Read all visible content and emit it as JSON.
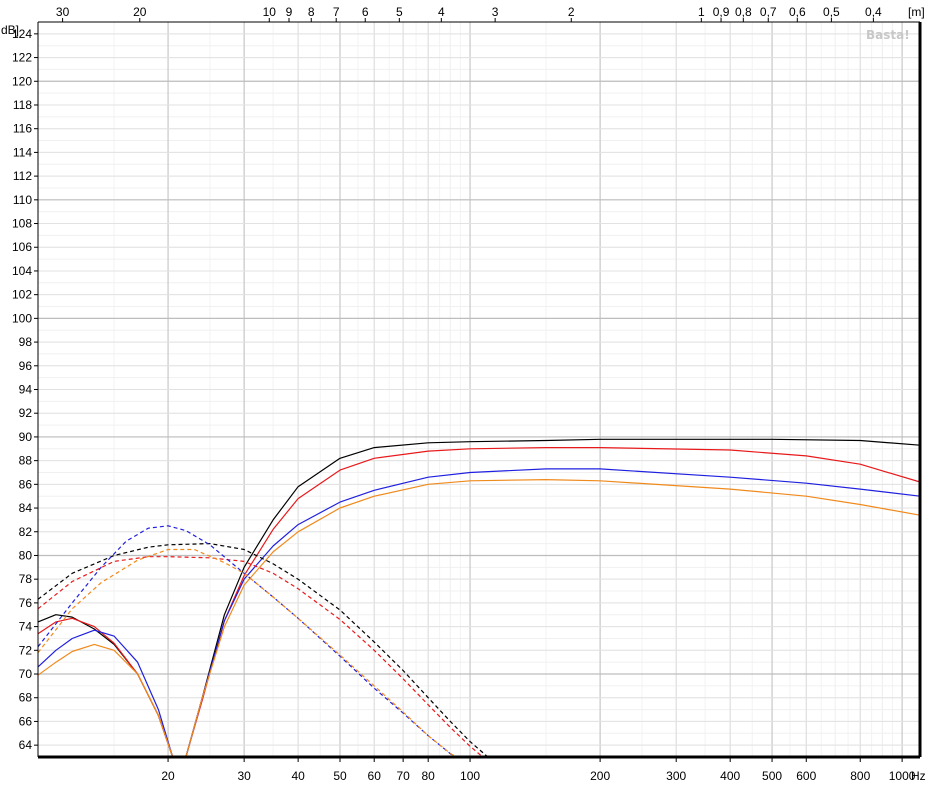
{
  "chart_data": {
    "type": "line",
    "title": "",
    "xlabel": "",
    "ylabel": "",
    "x_scale": "log",
    "xlim": [
      10,
      1100
    ],
    "ylim": [
      63,
      125
    ],
    "grid": true,
    "watermark": "Basta!",
    "y_unit_label": "dB]",
    "x_unit_label": "Hz",
    "top_unit_label": "[m]",
    "x_ticks": [
      {
        "v": 20,
        "label": "20"
      },
      {
        "v": 30,
        "label": "30"
      },
      {
        "v": 40,
        "label": "40"
      },
      {
        "v": 50,
        "label": "50"
      },
      {
        "v": 60,
        "label": "60"
      },
      {
        "v": 70,
        "label": "70"
      },
      {
        "v": 80,
        "label": "80"
      },
      {
        "v": 100,
        "label": "100"
      },
      {
        "v": 200,
        "label": "200"
      },
      {
        "v": 300,
        "label": "300"
      },
      {
        "v": 400,
        "label": "400"
      },
      {
        "v": 500,
        "label": "500"
      },
      {
        "v": 600,
        "label": "600"
      },
      {
        "v": 800,
        "label": "800"
      },
      {
        "v": 1000,
        "label": "1000"
      }
    ],
    "y_ticks": [
      64,
      66,
      68,
      70,
      72,
      74,
      76,
      78,
      80,
      82,
      84,
      86,
      88,
      90,
      92,
      94,
      96,
      98,
      100,
      102,
      104,
      106,
      108,
      110,
      112,
      114,
      116,
      118,
      120,
      122,
      124
    ],
    "top_ticks": [
      {
        "label": "30",
        "hz": 11.4
      },
      {
        "label": "20",
        "hz": 17.2
      },
      {
        "label": "10",
        "hz": 34.3
      },
      {
        "label": "9",
        "hz": 38.1
      },
      {
        "label": "8",
        "hz": 42.9
      },
      {
        "label": "7",
        "hz": 49.0
      },
      {
        "label": "6",
        "hz": 57.2
      },
      {
        "label": "5",
        "hz": 68.6
      },
      {
        "label": "4",
        "hz": 85.8
      },
      {
        "label": "3",
        "hz": 114.3
      },
      {
        "label": "2",
        "hz": 171.5
      },
      {
        "label": "1",
        "hz": 343
      },
      {
        "label": "0,9",
        "hz": 381
      },
      {
        "label": "0,8",
        "hz": 429
      },
      {
        "label": "0,7",
        "hz": 490
      },
      {
        "label": "0,6",
        "hz": 572
      },
      {
        "label": "0,5",
        "hz": 686
      },
      {
        "label": "0,4",
        "hz": 858
      }
    ],
    "series": [
      {
        "color": "#000000",
        "dash": false,
        "points": [
          [
            10,
            74.4
          ],
          [
            11,
            75.0
          ],
          [
            12,
            74.8
          ],
          [
            13.5,
            73.8
          ],
          [
            15,
            72.5
          ],
          [
            17,
            70.0
          ],
          [
            19,
            66.5
          ],
          [
            20.5,
            63
          ]
        ]
      },
      {
        "color": "#000000",
        "dash": false,
        "points": [
          [
            22,
            63
          ],
          [
            24,
            68
          ],
          [
            27,
            75
          ],
          [
            30,
            79
          ],
          [
            35,
            83
          ],
          [
            40,
            85.8
          ],
          [
            50,
            88.2
          ],
          [
            60,
            89.1
          ],
          [
            80,
            89.5
          ],
          [
            100,
            89.6
          ],
          [
            150,
            89.7
          ],
          [
            200,
            89.8
          ],
          [
            500,
            89.8
          ],
          [
            800,
            89.7
          ],
          [
            1100,
            89.3
          ]
        ]
      },
      {
        "color": "#e8191b",
        "dash": false,
        "points": [
          [
            10,
            73.4
          ],
          [
            11,
            74.4
          ],
          [
            12,
            74.7
          ],
          [
            13.5,
            74.0
          ],
          [
            15,
            72.6
          ],
          [
            17,
            70.0
          ],
          [
            19,
            66.5
          ],
          [
            20.5,
            63
          ]
        ]
      },
      {
        "color": "#e8191b",
        "dash": false,
        "points": [
          [
            22,
            63
          ],
          [
            24,
            67.8
          ],
          [
            27,
            74.5
          ],
          [
            30,
            78.3
          ],
          [
            35,
            82.2
          ],
          [
            40,
            84.8
          ],
          [
            50,
            87.2
          ],
          [
            60,
            88.2
          ],
          [
            80,
            88.8
          ],
          [
            100,
            89.0
          ],
          [
            150,
            89.1
          ],
          [
            200,
            89.1
          ],
          [
            400,
            88.9
          ],
          [
            600,
            88.4
          ],
          [
            800,
            87.7
          ],
          [
            1100,
            86.2
          ]
        ]
      },
      {
        "color": "#2020e0",
        "dash": false,
        "points": [
          [
            10,
            70.6
          ],
          [
            11,
            72.0
          ],
          [
            12,
            73.0
          ],
          [
            13.5,
            73.7
          ],
          [
            15,
            73.2
          ],
          [
            17,
            71.0
          ],
          [
            19,
            67.0
          ],
          [
            20.5,
            63
          ]
        ]
      },
      {
        "color": "#2020e0",
        "dash": false,
        "points": [
          [
            22,
            63
          ],
          [
            24,
            68
          ],
          [
            27,
            74.5
          ],
          [
            30,
            78.0
          ],
          [
            35,
            80.8
          ],
          [
            40,
            82.6
          ],
          [
            50,
            84.5
          ],
          [
            60,
            85.5
          ],
          [
            80,
            86.6
          ],
          [
            100,
            87.0
          ],
          [
            150,
            87.3
          ],
          [
            200,
            87.3
          ],
          [
            400,
            86.6
          ],
          [
            600,
            86.1
          ],
          [
            800,
            85.6
          ],
          [
            1100,
            85.0
          ]
        ]
      },
      {
        "color": "#f08a1c",
        "dash": false,
        "points": [
          [
            10,
            69.9
          ],
          [
            11,
            71.0
          ],
          [
            12,
            71.9
          ],
          [
            13.5,
            72.5
          ],
          [
            15,
            72.0
          ],
          [
            17,
            70.0
          ],
          [
            19,
            66.5
          ],
          [
            20.5,
            63
          ]
        ]
      },
      {
        "color": "#f08a1c",
        "dash": false,
        "points": [
          [
            22,
            63
          ],
          [
            24,
            68
          ],
          [
            27,
            74
          ],
          [
            30,
            77.5
          ],
          [
            35,
            80.3
          ],
          [
            40,
            82.0
          ],
          [
            50,
            84.0
          ],
          [
            60,
            85.0
          ],
          [
            80,
            86.0
          ],
          [
            100,
            86.3
          ],
          [
            150,
            86.4
          ],
          [
            200,
            86.3
          ],
          [
            400,
            85.6
          ],
          [
            600,
            85.0
          ],
          [
            800,
            84.3
          ],
          [
            1100,
            83.4
          ]
        ]
      },
      {
        "color": "#000000",
        "dash": true,
        "points": [
          [
            10,
            76.3
          ],
          [
            12,
            78.5
          ],
          [
            15,
            80.0
          ],
          [
            18,
            80.7
          ],
          [
            20,
            80.9
          ],
          [
            25,
            81.0
          ],
          [
            30,
            80.5
          ],
          [
            35,
            79.3
          ],
          [
            40,
            78.0
          ],
          [
            50,
            75.4
          ],
          [
            60,
            72.7
          ],
          [
            70,
            70.3
          ],
          [
            80,
            68.0
          ],
          [
            90,
            66.0
          ],
          [
            100,
            64.3
          ],
          [
            110,
            63
          ]
        ]
      },
      {
        "color": "#e8191b",
        "dash": true,
        "points": [
          [
            10,
            75.5
          ],
          [
            12,
            77.8
          ],
          [
            15,
            79.5
          ],
          [
            18,
            79.9
          ],
          [
            20,
            79.9
          ],
          [
            25,
            79.8
          ],
          [
            30,
            79.5
          ],
          [
            35,
            78.5
          ],
          [
            40,
            77.2
          ],
          [
            50,
            74.6
          ],
          [
            60,
            72.0
          ],
          [
            70,
            69.6
          ],
          [
            80,
            67.4
          ],
          [
            90,
            65.5
          ],
          [
            100,
            63.9
          ],
          [
            107,
            63
          ]
        ]
      },
      {
        "color": "#2020e0",
        "dash": true,
        "points": [
          [
            10,
            72.3
          ],
          [
            12,
            76.0
          ],
          [
            14,
            79.0
          ],
          [
            16,
            81.2
          ],
          [
            18,
            82.3
          ],
          [
            20,
            82.5
          ],
          [
            22,
            82.1
          ],
          [
            25,
            80.9
          ],
          [
            30,
            78.5
          ],
          [
            35,
            76.5
          ],
          [
            40,
            74.7
          ],
          [
            50,
            71.5
          ],
          [
            60,
            68.8
          ],
          [
            70,
            66.7
          ],
          [
            80,
            64.8
          ],
          [
            92,
            63
          ]
        ]
      },
      {
        "color": "#f08a1c",
        "dash": true,
        "points": [
          [
            10,
            71.8
          ],
          [
            12,
            75.5
          ],
          [
            14,
            77.7
          ],
          [
            17,
            79.6
          ],
          [
            20,
            80.5
          ],
          [
            23,
            80.5
          ],
          [
            27,
            79.4
          ],
          [
            30,
            78.5
          ],
          [
            35,
            76.5
          ],
          [
            40,
            74.7
          ],
          [
            50,
            71.6
          ],
          [
            60,
            69.0
          ],
          [
            70,
            66.8
          ],
          [
            80,
            64.8
          ],
          [
            90,
            63.3
          ],
          [
            93,
            63
          ]
        ]
      }
    ]
  }
}
